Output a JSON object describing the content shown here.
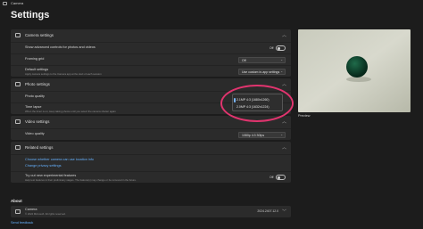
{
  "window": {
    "title": "Camera",
    "icon": "camera-icon"
  },
  "page_title": "Settings",
  "camera_settings": {
    "header": "Camera settings",
    "advanced_controls": {
      "label": "Show advanced controls for photos and videos",
      "state": "Off"
    },
    "framing_grid": {
      "label": "Framing grid",
      "value": "Off"
    },
    "default_settings": {
      "label": "Default settings",
      "sub": "Apply camera settings to the Camera app at the start of each session",
      "value": "Use custom in-app settings"
    }
  },
  "photo_settings": {
    "header": "Photo settings",
    "photo_quality": {
      "label": "Photo quality"
    },
    "time_lapse": {
      "label": "Time lapse",
      "sub": "When the timer is on, keep taking photos until you select the camera shutter again"
    },
    "options": [
      "2.1MP 4:3 (1680x1260)",
      "2.0MP 4:3 (1632x1224)"
    ]
  },
  "video_settings": {
    "header": "Video settings",
    "video_quality": {
      "label": "Video quality",
      "value": "1080p 4:3 30fps"
    }
  },
  "related_settings": {
    "header": "Related settings",
    "links": [
      "Choose whether camera can use location info",
      "Change privacy settings"
    ],
    "experimental": {
      "label": "Try out new experimental features",
      "sub": "Help test features in their preliminary stages. The feature(s) may change or be removed in the future.",
      "state": "Off"
    }
  },
  "about": {
    "label": "About",
    "app_name": "Camera",
    "copyright": "© 2024 Microsoft. All rights reserved.",
    "version": "2024.2407.12.0"
  },
  "send_feedback": "Send feedback",
  "preview": {
    "label": "Preview"
  },
  "accent": "#e0346e",
  "link_color": "#66b2ff"
}
